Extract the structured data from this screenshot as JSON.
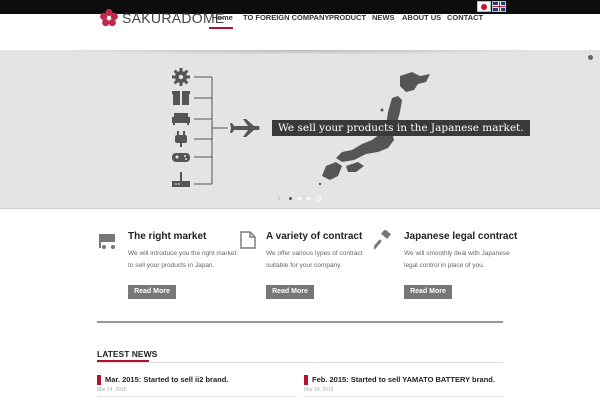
{
  "brand": "SAKURADOME",
  "nav": [
    "Home",
    "TO FOREIGN COMPANY",
    "PRODUCT",
    "NEWS",
    "ABOUT US",
    "CONTACT"
  ],
  "hero": {
    "caption": "We sell your products in the Japanese market.",
    "pager_prev": "‹"
  },
  "features": [
    {
      "title": "The right market",
      "text": "We will introduce you the right market to sell your products in Japan.",
      "button": "Read More",
      "icon": "cart-icon"
    },
    {
      "title": "A variety of contract",
      "text": "We offer various types of contract suitable for your company.",
      "button": "Read More",
      "icon": "document-icon"
    },
    {
      "title": "Japanese legal contract",
      "text": "We will smoothly deal with Japanese legal control in place of you.",
      "button": "Read More",
      "icon": "gavel-icon"
    }
  ],
  "latest_news": {
    "heading": "LATEST NEWS",
    "items": [
      {
        "title": "Mar. 2015: Started to sell ii2 brand.",
        "date": "Mar 14, 2015"
      },
      {
        "title": "Feb. 2015: Started to sell YAMATO BATTERY brand.",
        "date": "Mar 14, 2015"
      }
    ]
  },
  "colors": {
    "accent": "#b5122f",
    "button": "#777777",
    "hero_bg": "#e4e4e4"
  }
}
